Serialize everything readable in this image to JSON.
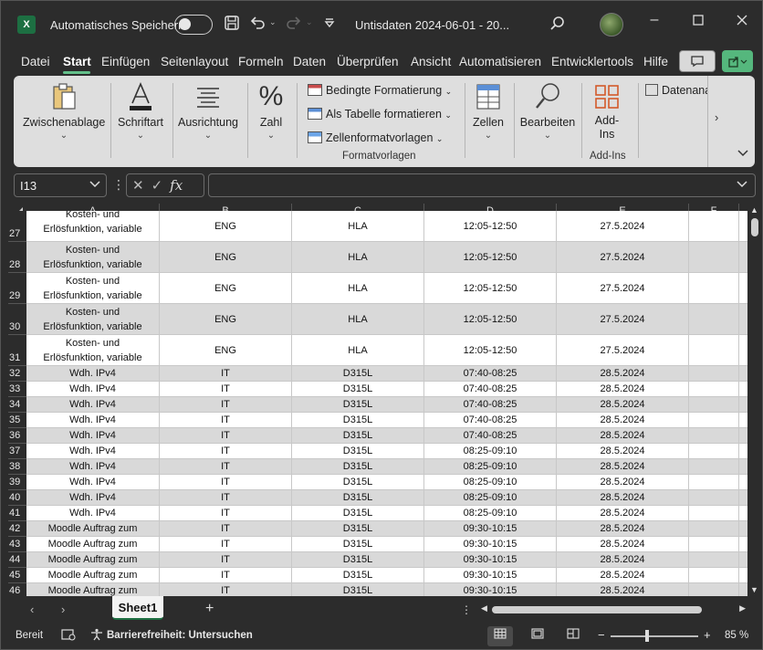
{
  "titlebar": {
    "logo": "X",
    "autosave_label": "Automatisches Speichern",
    "doc_title": "Untisdaten 2024-06-01 - 20...",
    "save_icon": "save-icon",
    "undo_icon": "undo-icon",
    "redo_icon": "redo-icon",
    "search_icon": "search-icon"
  },
  "menu": {
    "tabs": [
      "Datei",
      "Start",
      "Einfügen",
      "Seitenlayout",
      "Formeln",
      "Daten",
      "Überprüfen",
      "Ansicht",
      "Automatisieren",
      "Entwicklertools",
      "Hilfe"
    ],
    "active": "Start"
  },
  "ribbon": {
    "clipboard": "Zwischenablage",
    "font": "Schriftart",
    "alignment": "Ausrichtung",
    "number": "Zahl",
    "conditional": "Bedingte Formatierung",
    "as_table": "Als Tabelle formatieren",
    "cell_styles": "Zellenformatvorlagen",
    "styles_caption": "Formatvorlagen",
    "cells": "Zellen",
    "edit": "Bearbeiten",
    "addins_line1": "Add-",
    "addins_line2": "Ins",
    "addins_caption": "Add-Ins",
    "data_analysis": "Datenana"
  },
  "formula_bar": {
    "name_box": "I13",
    "fx": "fx",
    "formula": ""
  },
  "columns": [
    "A",
    "B",
    "C",
    "D",
    "E",
    "F"
  ],
  "rows": [
    {
      "n": "27",
      "a1": "Kosten- und",
      "a2": "Erlösfunktion, variable",
      "b": "ENG",
      "c": "HLA",
      "d": "12:05-12:50",
      "e": "27.5.2024",
      "shade": false
    },
    {
      "n": "28",
      "a1": "Kosten- und",
      "a2": "Erlösfunktion, variable",
      "b": "ENG",
      "c": "HLA",
      "d": "12:05-12:50",
      "e": "27.5.2024",
      "shade": true
    },
    {
      "n": "29",
      "a1": "Kosten- und",
      "a2": "Erlösfunktion, variable",
      "b": "ENG",
      "c": "HLA",
      "d": "12:05-12:50",
      "e": "27.5.2024",
      "shade": false
    },
    {
      "n": "30",
      "a1": "Kosten- und",
      "a2": "Erlösfunktion, variable",
      "b": "ENG",
      "c": "HLA",
      "d": "12:05-12:50",
      "e": "27.5.2024",
      "shade": true
    },
    {
      "n": "31",
      "a1": "Kosten- und",
      "a2": "Erlösfunktion, variable",
      "b": "ENG",
      "c": "HLA",
      "d": "12:05-12:50",
      "e": "27.5.2024",
      "shade": false
    },
    {
      "n": "32",
      "a1": "Wdh. IPv4",
      "b": "IT",
      "c": "D315L",
      "d": "07:40-08:25",
      "e": "28.5.2024",
      "shade": true
    },
    {
      "n": "33",
      "a1": "Wdh. IPv4",
      "b": "IT",
      "c": "D315L",
      "d": "07:40-08:25",
      "e": "28.5.2024",
      "shade": false
    },
    {
      "n": "34",
      "a1": "Wdh. IPv4",
      "b": "IT",
      "c": "D315L",
      "d": "07:40-08:25",
      "e": "28.5.2024",
      "shade": true
    },
    {
      "n": "35",
      "a1": "Wdh. IPv4",
      "b": "IT",
      "c": "D315L",
      "d": "07:40-08:25",
      "e": "28.5.2024",
      "shade": false
    },
    {
      "n": "36",
      "a1": "Wdh. IPv4",
      "b": "IT",
      "c": "D315L",
      "d": "07:40-08:25",
      "e": "28.5.2024",
      "shade": true
    },
    {
      "n": "37",
      "a1": "Wdh. IPv4",
      "b": "IT",
      "c": "D315L",
      "d": "08:25-09:10",
      "e": "28.5.2024",
      "shade": false
    },
    {
      "n": "38",
      "a1": "Wdh. IPv4",
      "b": "IT",
      "c": "D315L",
      "d": "08:25-09:10",
      "e": "28.5.2024",
      "shade": true
    },
    {
      "n": "39",
      "a1": "Wdh. IPv4",
      "b": "IT",
      "c": "D315L",
      "d": "08:25-09:10",
      "e": "28.5.2024",
      "shade": false
    },
    {
      "n": "40",
      "a1": "Wdh. IPv4",
      "b": "IT",
      "c": "D315L",
      "d": "08:25-09:10",
      "e": "28.5.2024",
      "shade": true
    },
    {
      "n": "41",
      "a1": "Wdh. IPv4",
      "b": "IT",
      "c": "D315L",
      "d": "08:25-09:10",
      "e": "28.5.2024",
      "shade": false
    },
    {
      "n": "42",
      "a1": "Moodle Auftrag zum",
      "b": "IT",
      "c": "D315L",
      "d": "09:30-10:15",
      "e": "28.5.2024",
      "shade": true
    },
    {
      "n": "43",
      "a1": "Moodle Auftrag zum",
      "b": "IT",
      "c": "D315L",
      "d": "09:30-10:15",
      "e": "28.5.2024",
      "shade": false
    },
    {
      "n": "44",
      "a1": "Moodle Auftrag zum",
      "b": "IT",
      "c": "D315L",
      "d": "09:30-10:15",
      "e": "28.5.2024",
      "shade": true
    },
    {
      "n": "45",
      "a1": "Moodle Auftrag zum",
      "b": "IT",
      "c": "D315L",
      "d": "09:30-10:15",
      "e": "28.5.2024",
      "shade": false
    },
    {
      "n": "46",
      "a1": "Moodle Auftrag zum",
      "b": "IT",
      "c": "D315L",
      "d": "09:30-10:15",
      "e": "28.5.2024",
      "shade": true
    }
  ],
  "sheets": {
    "active": "Sheet1"
  },
  "status": {
    "ready": "Bereit",
    "accessibility": "Barrierefreiheit: Untersuchen",
    "zoom_minus": "−",
    "zoom_plus": "+",
    "zoom": "85 %"
  }
}
